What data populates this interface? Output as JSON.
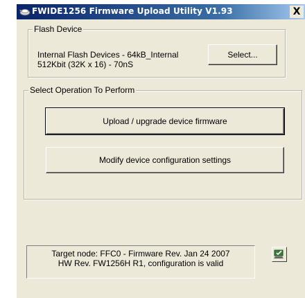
{
  "window": {
    "title": "FWIDE1256 Firmware Upload Utility V1.93",
    "close_label": "X",
    "titlebar_colors": [
      "#0a246a",
      "#a6caf0"
    ]
  },
  "flash_device": {
    "group_label": "Flash Device",
    "device_line1": "Internal Flash Devices - 64kB_Internal",
    "device_line2": "512Kbit (32K x 16) - 70nS",
    "select_button": "Select..."
  },
  "operations": {
    "group_label": "Select Operation To Perform",
    "upload_button": "Upload / upgrade device firmware",
    "modify_button": "Modify device configuration settings"
  },
  "status": {
    "line1": "Target node: FFC0 - Firmware Rev. Jan 24 2007",
    "line2": "HW Rev. FW1256H R1, configuration is valid",
    "icon": "device-status-icon"
  }
}
